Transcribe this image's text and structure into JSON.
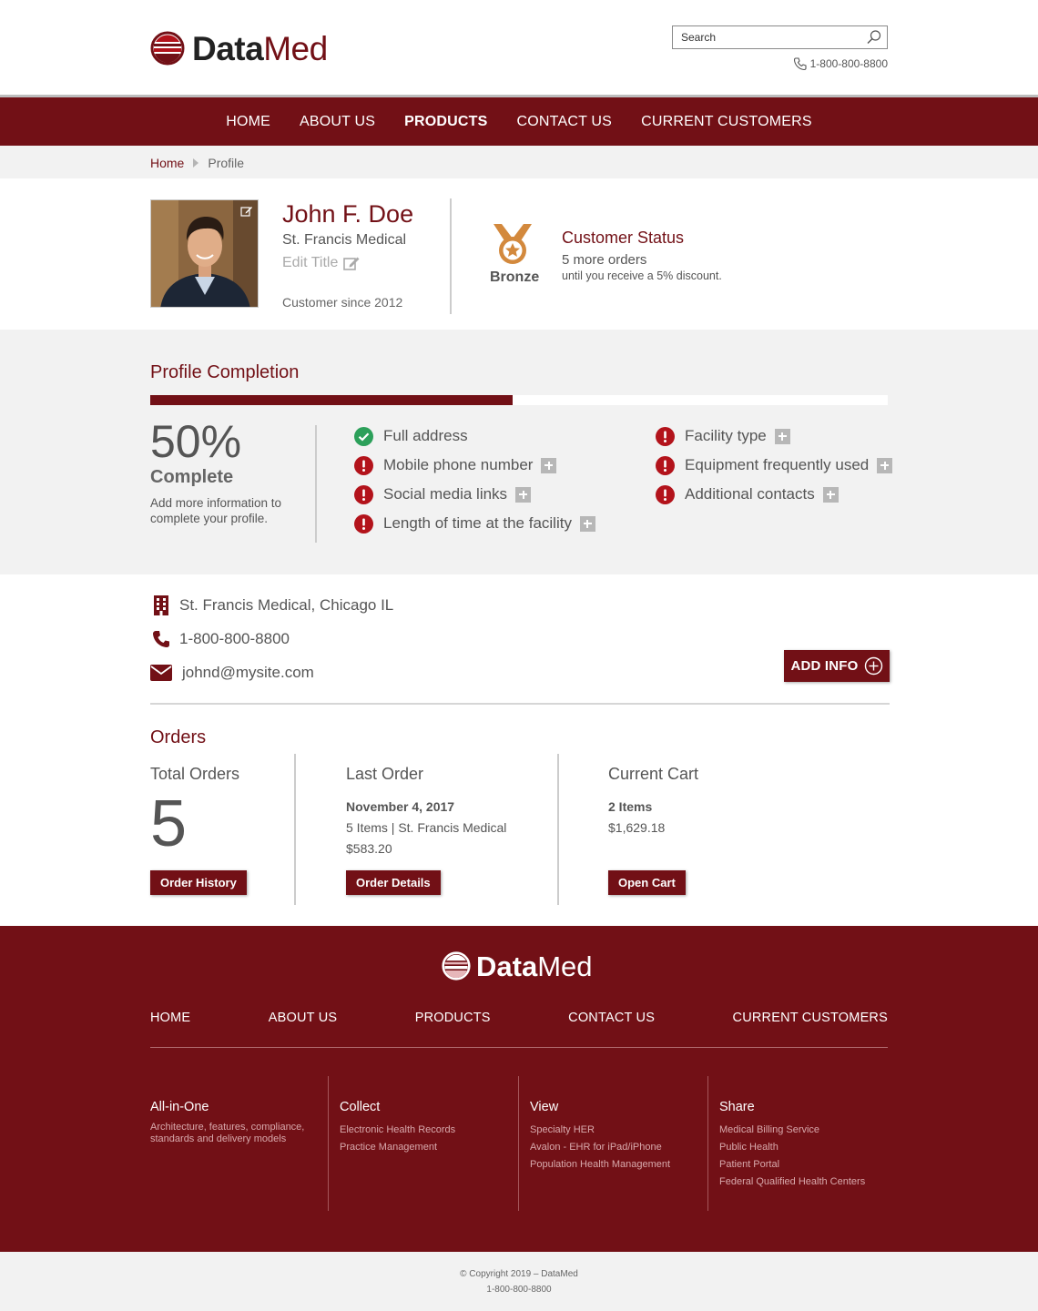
{
  "brand": {
    "name_bold": "Data",
    "name_light": "Med",
    "accent_color": "#721016"
  },
  "header": {
    "search_placeholder": "Search",
    "phone": "1-800-800-8800"
  },
  "nav": {
    "items": [
      {
        "label": "HOME",
        "active": false
      },
      {
        "label": "ABOUT US",
        "active": false
      },
      {
        "label": "PRODUCTS",
        "active": true
      },
      {
        "label": "CONTACT US",
        "active": false
      },
      {
        "label": "CURRENT CUSTOMERS",
        "active": false
      }
    ]
  },
  "breadcrumb": {
    "home": "Home",
    "current": "Profile"
  },
  "profile": {
    "name": "John F. Doe",
    "organization": "St. Francis Medical",
    "title_placeholder": "Edit Title",
    "since": "Customer since 2012"
  },
  "status": {
    "medal": "Bronze",
    "medal_color": "#d3893d",
    "title": "Customer Status",
    "orders_line": "5 more orders",
    "note": "until you receive a 5% discount."
  },
  "completion": {
    "title": "Profile Completion",
    "percent": 50,
    "percent_label": "50%",
    "complete_label": "Complete",
    "help": "Add more information to complete your profile.",
    "items_left": [
      {
        "label": "Full address",
        "done": true
      },
      {
        "label": "Mobile phone number",
        "done": false
      },
      {
        "label": "Social media links",
        "done": false
      },
      {
        "label": "Length of time at the facility",
        "done": false
      }
    ],
    "items_right": [
      {
        "label": "Facility type",
        "done": false
      },
      {
        "label": "Equipment frequently used",
        "done": false
      },
      {
        "label": "Additional contacts",
        "done": false
      }
    ],
    "done_color": "#2ca05a",
    "todo_color": "#b3131b"
  },
  "contact": {
    "address": "St. Francis Medical, Chicago IL",
    "phone": "1-800-800-8800",
    "email": "johnd@mysite.com",
    "add_info_label": "ADD INFO"
  },
  "orders": {
    "title": "Orders",
    "total": {
      "heading": "Total Orders",
      "count": "5",
      "button": "Order History"
    },
    "last": {
      "heading": "Last Order",
      "date": "November 4, 2017",
      "summary": "5 Items | St. Francis Medical",
      "amount": "$583.20",
      "button": "Order Details"
    },
    "cart": {
      "heading": "Current Cart",
      "items": "2 Items",
      "amount": "$1,629.18",
      "button": "Open Cart"
    }
  },
  "footer": {
    "nav": [
      "HOME",
      "ABOUT US",
      "PRODUCTS",
      "CONTACT US",
      "CURRENT CUSTOMERS"
    ],
    "columns": [
      {
        "heading": "All-in-One",
        "description": "Architecture, features, compliance, standards and delivery models",
        "links": []
      },
      {
        "heading": "Collect",
        "links": [
          "Electronic Health Records",
          "Practice Management"
        ]
      },
      {
        "heading": "View",
        "links": [
          "Specialty HER",
          "Avalon - EHR for iPad/iPhone",
          "Population Health Management"
        ]
      },
      {
        "heading": "Share",
        "links": [
          "Medical Billing Service",
          "Public Health",
          "Patient Portal",
          "Federal Qualified Health Centers"
        ]
      }
    ],
    "copyright": "© Copyright 2019 – DataMed",
    "phone": "1-800-800-8800"
  }
}
